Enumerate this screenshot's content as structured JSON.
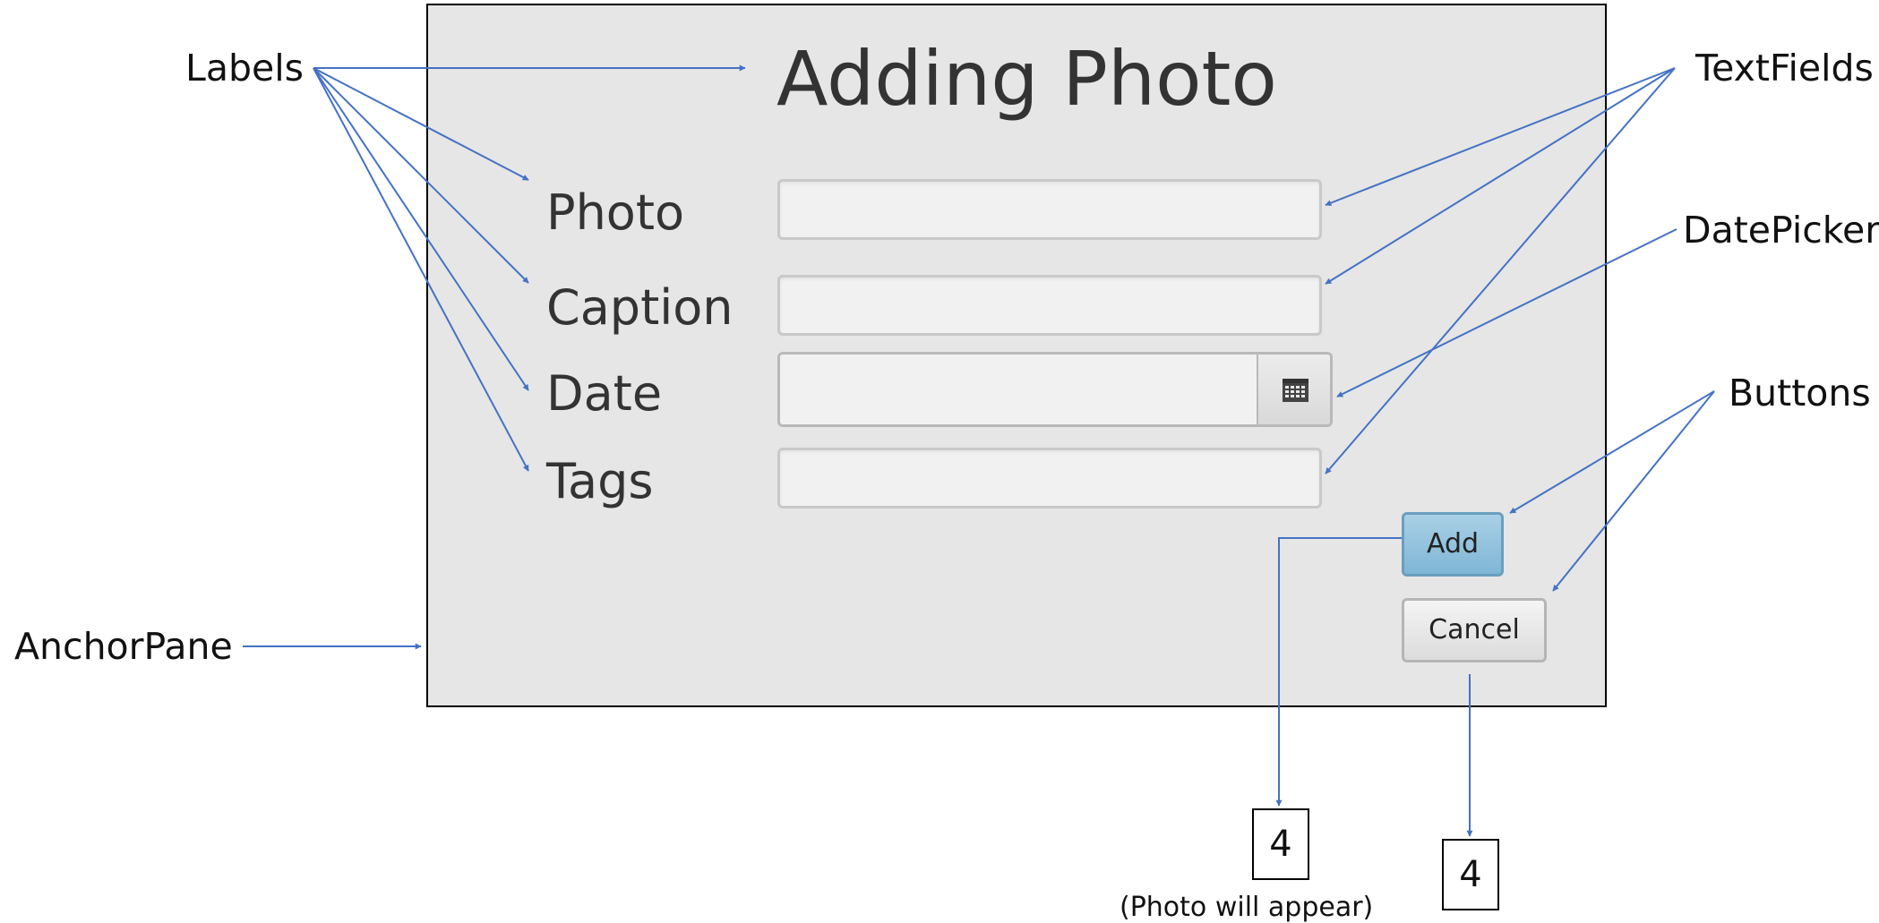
{
  "annotations": {
    "labels": "Labels",
    "textfields": "TextFields",
    "datepicker": "DatePicker",
    "buttons": "Buttons",
    "anchorpane": "AnchorPane"
  },
  "dialog": {
    "title": "Adding Photo",
    "fields": {
      "photo": {
        "label": "Photo",
        "value": ""
      },
      "caption": {
        "label": "Caption",
        "value": ""
      },
      "date": {
        "label": "Date",
        "value": ""
      },
      "tags": {
        "label": "Tags",
        "value": ""
      }
    },
    "buttons": {
      "add": "Add",
      "cancel": "Cancel"
    }
  },
  "steps": {
    "add": {
      "number": "4",
      "note": "(Photo will appear)"
    },
    "cancel": {
      "number": "4"
    }
  },
  "colors": {
    "annotation_line": "#4472c4",
    "pane_background": "#e6e6e6",
    "add_button": "#8fc0dc"
  }
}
